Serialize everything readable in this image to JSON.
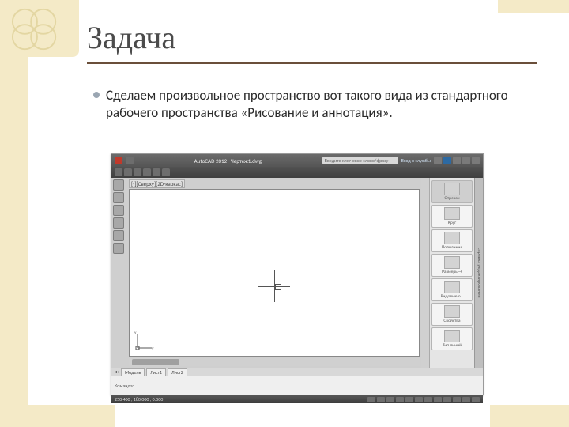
{
  "slide": {
    "title": "Задача",
    "bullet": "Сделаем произвольное пространство вот такого вида из стандартного рабочего пространства «Рисование и аннотация»."
  },
  "app": {
    "product": "AutoCAD 2012",
    "doc": "Чертеж1.dwg",
    "search_placeholder": "Введите ключевое слово/фразу",
    "login": "Вход в службы",
    "viewport_label": "[-][Сверху][2D-каркас]",
    "ucs_x": "X",
    "ucs_y": "Y",
    "tabs": [
      "Модель",
      "Лист1",
      "Лист2"
    ],
    "status_coord": "250  400 , 180  000 , 0.000",
    "cmd_prompt": "Команда:",
    "palettes": [
      "Отрезок",
      "Круг",
      "Полилиния",
      "Размеры→",
      "Видовые о…",
      "Свойства",
      "Тип линий"
    ],
    "right_strip": "справка  редактирование"
  }
}
